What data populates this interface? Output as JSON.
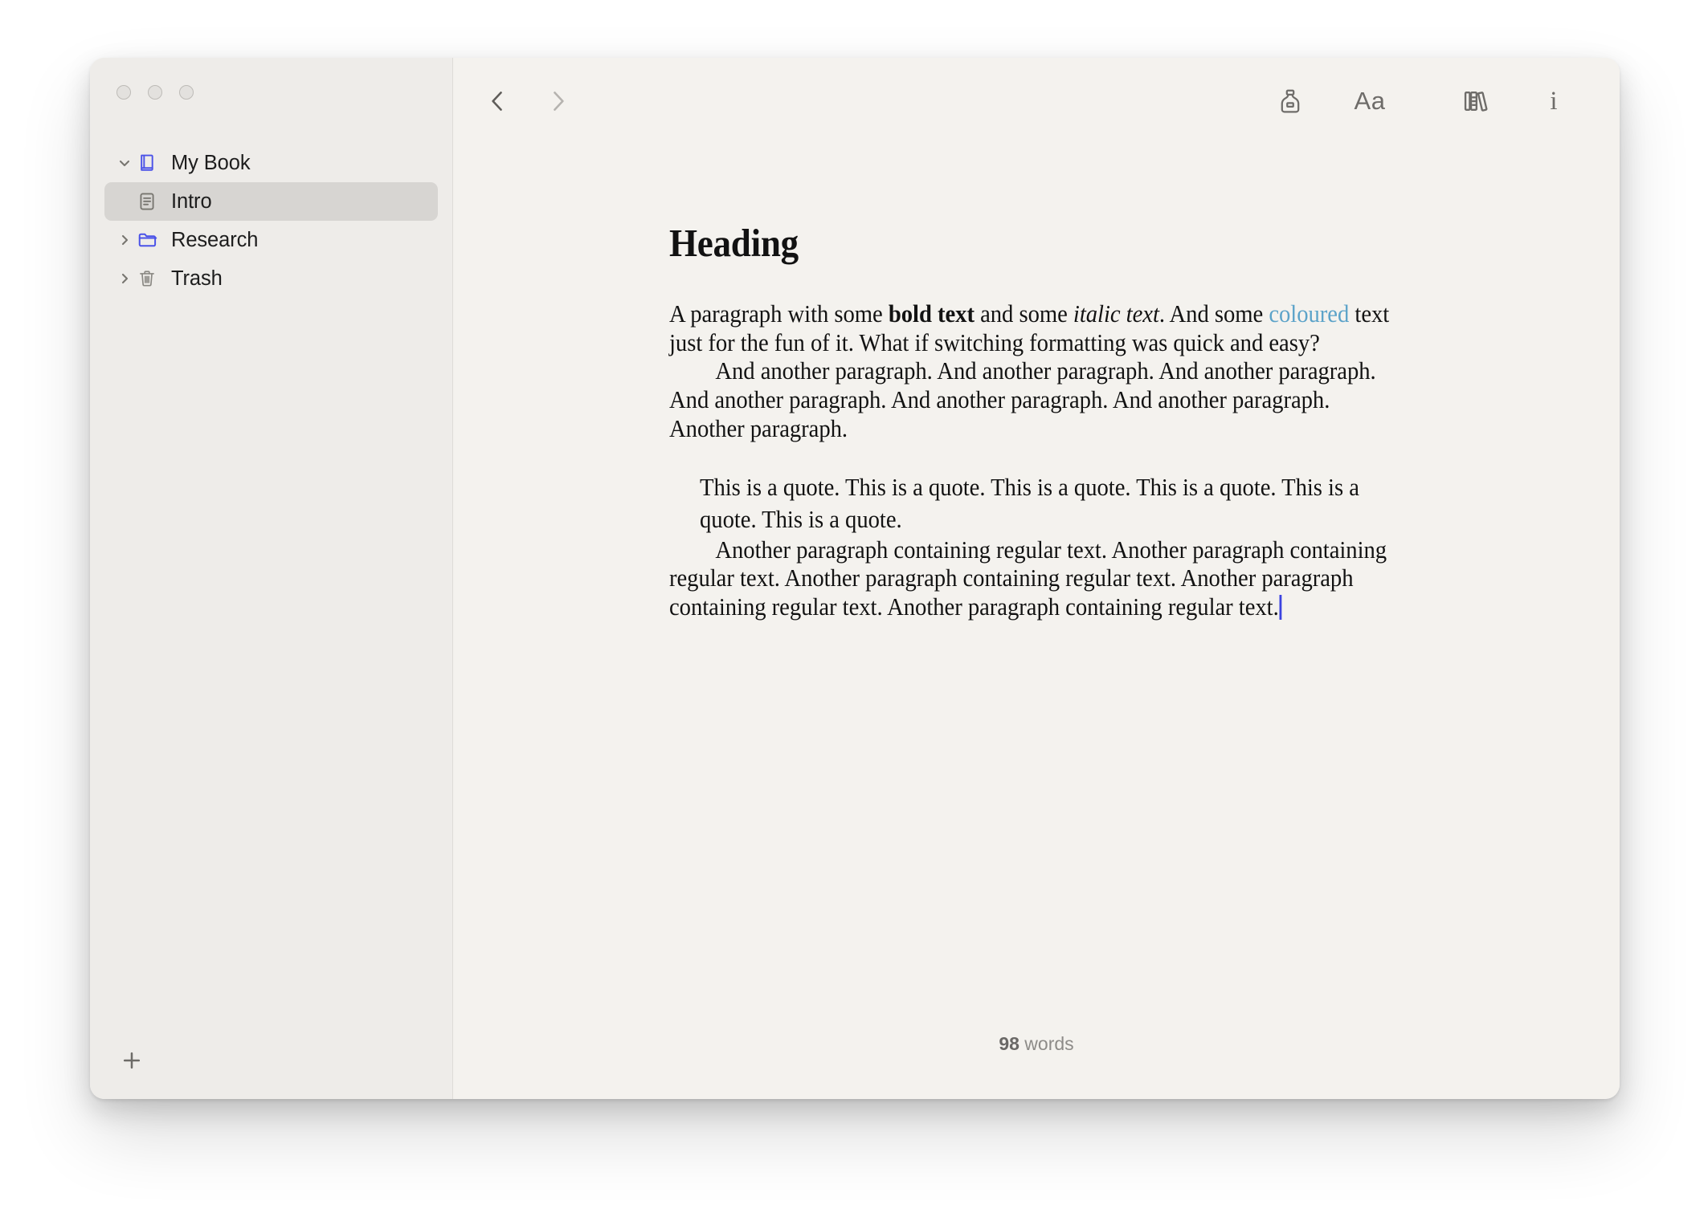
{
  "window": {
    "traffic_lights": [
      "close",
      "minimize",
      "zoom"
    ]
  },
  "sidebar": {
    "items": [
      {
        "label": "My Book",
        "icon": "book-icon",
        "indent": 0,
        "disclosure": "expanded",
        "selected": false
      },
      {
        "label": "Intro",
        "icon": "document-icon",
        "indent": 1,
        "disclosure": "none",
        "selected": true
      },
      {
        "label": "Research",
        "icon": "folder-icon",
        "indent": 0,
        "disclosure": "collapsed",
        "selected": false
      },
      {
        "label": "Trash",
        "icon": "trash-icon",
        "indent": 0,
        "disclosure": "collapsed",
        "selected": false
      }
    ],
    "add_button": {
      "icon": "plus-icon",
      "label": "+"
    }
  },
  "toolbar": {
    "back": {
      "icon": "chevron-left-icon",
      "enabled": true
    },
    "forward": {
      "icon": "chevron-right-icon",
      "enabled": false
    },
    "ink": {
      "icon": "inkwell-icon"
    },
    "typography": {
      "icon": "typography-icon",
      "label": "Aa"
    },
    "library": {
      "icon": "bookshelf-icon"
    },
    "info": {
      "icon": "info-icon",
      "label": "i"
    }
  },
  "document": {
    "heading": "Heading",
    "p1_part1": "A paragraph with some ",
    "p1_bold": "bold text",
    "p1_part2": " and some ",
    "p1_italic": "italic text",
    "p1_part3": ". And some ",
    "p1_coloured": "coloured",
    "p1_part4": " text just for the fun of it. What if switching formatting was quick and easy?",
    "p2": "And another paragraph. And another paragraph. And another paragraph. And another paragraph. And another paragraph. And another paragraph. Another paragraph.",
    "quote": "This is a quote. This is a quote. This is a quote. This is a quote. This is a quote. This is a quote.",
    "p3": "Another paragraph containing regular text. Another paragraph containing regular text. Another paragraph containing regular text. Another paragraph containing regular text. Another paragraph containing regular text."
  },
  "footer": {
    "word_count": "98",
    "word_count_unit": " words"
  },
  "colors": {
    "sidebar_bg": "#eeece9",
    "editor_bg": "#f4f2ee",
    "selection": "#d7d5d2",
    "accent_blue": "#4a52e8",
    "coloured_text": "#5ca3c9",
    "caret": "#3b42e0",
    "icon_grey": "#6e6c69"
  }
}
